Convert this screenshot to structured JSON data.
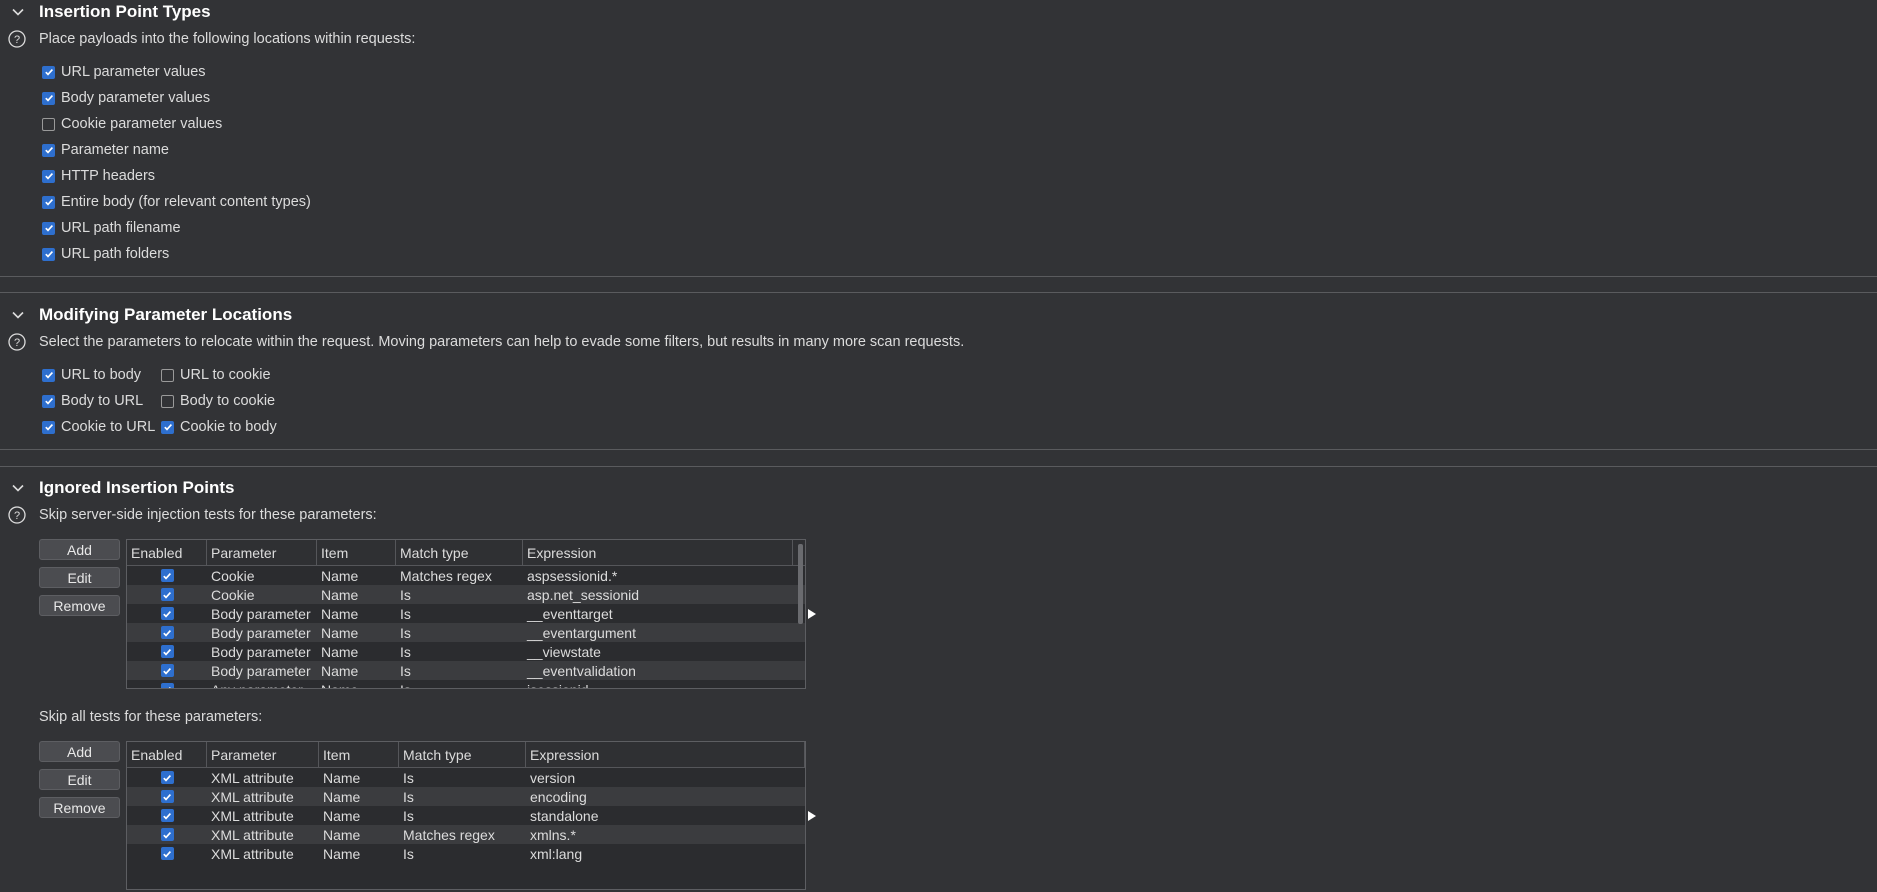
{
  "insertion": {
    "title": "Insertion Point Types",
    "description": "Place payloads into the following locations within requests:",
    "options": [
      {
        "label": "URL parameter values",
        "checked": true
      },
      {
        "label": "Body parameter values",
        "checked": true
      },
      {
        "label": "Cookie parameter values",
        "checked": false
      },
      {
        "label": "Parameter name",
        "checked": true
      },
      {
        "label": "HTTP headers",
        "checked": true
      },
      {
        "label": "Entire body (for relevant content types)",
        "checked": true
      },
      {
        "label": "URL path filename",
        "checked": true
      },
      {
        "label": "URL path folders",
        "checked": true
      }
    ]
  },
  "modifying": {
    "title": "Modifying Parameter Locations",
    "description": "Select the parameters to relocate within the request. Moving parameters can help to evade some filters, but results in many more scan requests.",
    "options": [
      {
        "label": "URL to body",
        "checked": true
      },
      {
        "label": "URL to cookie",
        "checked": false
      },
      {
        "label": "Body to URL",
        "checked": true
      },
      {
        "label": "Body to cookie",
        "checked": false
      },
      {
        "label": "Cookie to URL",
        "checked": true
      },
      {
        "label": "Cookie to body",
        "checked": true
      }
    ]
  },
  "ignored": {
    "title": "Ignored Insertion Points",
    "server_side_description": "Skip server-side injection tests for these parameters:",
    "all_tests_description": "Skip all tests for these parameters:",
    "buttons": {
      "add": "Add",
      "edit": "Edit",
      "remove": "Remove"
    },
    "columns": [
      "Enabled",
      "Parameter",
      "Item",
      "Match type",
      "Expression"
    ],
    "server_side_rows": [
      {
        "parameter": "Cookie",
        "item": "Name",
        "match": "Matches regex",
        "expression": "aspsessionid.*"
      },
      {
        "parameter": "Cookie",
        "item": "Name",
        "match": "Is",
        "expression": "asp.net_sessionid"
      },
      {
        "parameter": "Body parameter",
        "item": "Name",
        "match": "Is",
        "expression": "__eventtarget"
      },
      {
        "parameter": "Body parameter",
        "item": "Name",
        "match": "Is",
        "expression": "__eventargument"
      },
      {
        "parameter": "Body parameter",
        "item": "Name",
        "match": "Is",
        "expression": "__viewstate"
      },
      {
        "parameter": "Body parameter",
        "item": "Name",
        "match": "Is",
        "expression": "__eventvalidation"
      },
      {
        "parameter": "Any parameter",
        "item": "Name",
        "match": "Is",
        "expression": "jsessionid"
      }
    ],
    "all_tests_rows": [
      {
        "parameter": "XML attribute",
        "item": "Name",
        "match": "Is",
        "expression": "version"
      },
      {
        "parameter": "XML attribute",
        "item": "Name",
        "match": "Is",
        "expression": "encoding"
      },
      {
        "parameter": "XML attribute",
        "item": "Name",
        "match": "Is",
        "expression": "standalone"
      },
      {
        "parameter": "XML attribute",
        "item": "Name",
        "match": "Matches regex",
        "expression": "xmlns.*"
      },
      {
        "parameter": "XML attribute",
        "item": "Name",
        "match": "Is",
        "expression": "xml:lang"
      }
    ]
  },
  "icons": {
    "collapse": "chevron-down-icon",
    "help": "help-circle-icon",
    "check": "check-icon",
    "expand": "triangle-right-icon"
  },
  "colors": {
    "background": "#323336",
    "checkbox": "#2e6fce",
    "text": "#dcdcdc",
    "title": "#ffffff"
  }
}
